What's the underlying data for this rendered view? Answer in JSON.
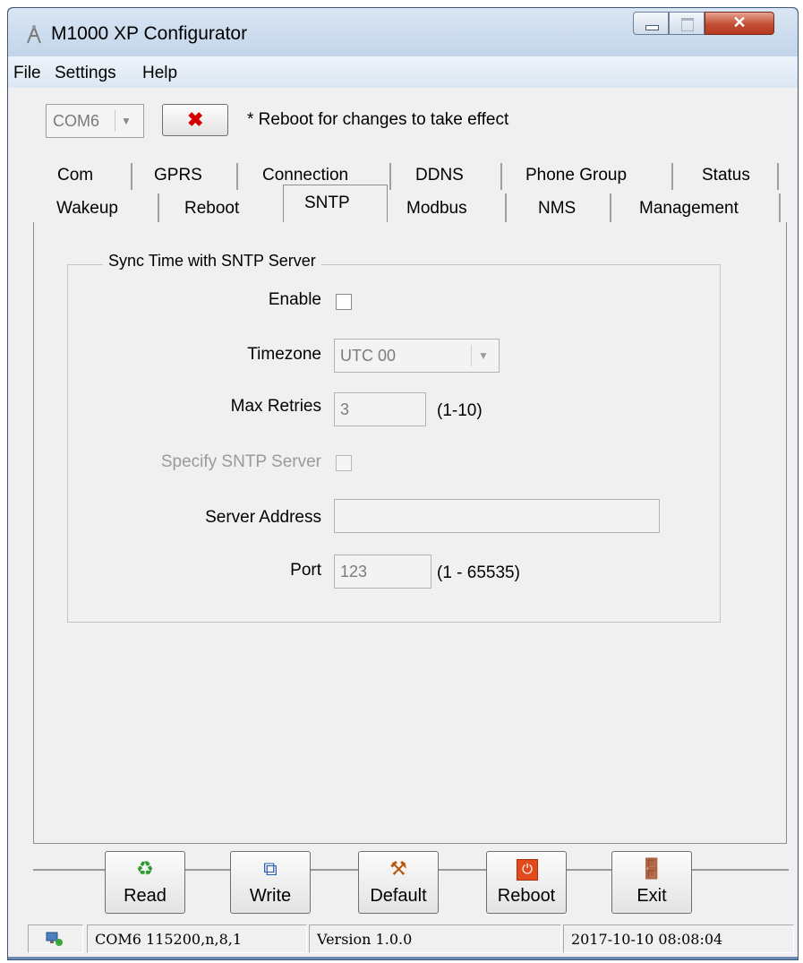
{
  "window": {
    "title": "M1000 XP Configurator"
  },
  "menu": [
    "File",
    "Settings",
    "Help"
  ],
  "toolbar": {
    "com_port": "COM6",
    "notice": "* Reboot for changes to take effect"
  },
  "tabs": {
    "row1": [
      "Com",
      "GPRS",
      "Connection",
      "DDNS",
      "Phone Group",
      "Status"
    ],
    "row2": [
      "Wakeup",
      "Reboot",
      "SNTP",
      "Modbus",
      "NMS",
      "Management"
    ],
    "active": "SNTP"
  },
  "sntp": {
    "group_title": "Sync Time with SNTP Server",
    "enable_label": "Enable",
    "enable_checked": false,
    "timezone_label": "Timezone",
    "timezone_value": "UTC 00",
    "max_retries_label": "Max Retries",
    "max_retries_value": "3",
    "max_retries_range": "(1-10)",
    "specify_server_label": "Specify SNTP Server",
    "specify_server_checked": false,
    "server_address_label": "Server Address",
    "server_address_value": "",
    "port_label": "Port",
    "port_value": "123",
    "port_range": "(1 - 65535)"
  },
  "buttons": {
    "read": "Read",
    "write": "Write",
    "default": "Default",
    "reboot": "Reboot",
    "exit": "Exit"
  },
  "status": {
    "connection": "COM6 115200,n,8,1",
    "version": "Version 1.0.0",
    "datetime": "2017-10-10 08:08:04"
  }
}
